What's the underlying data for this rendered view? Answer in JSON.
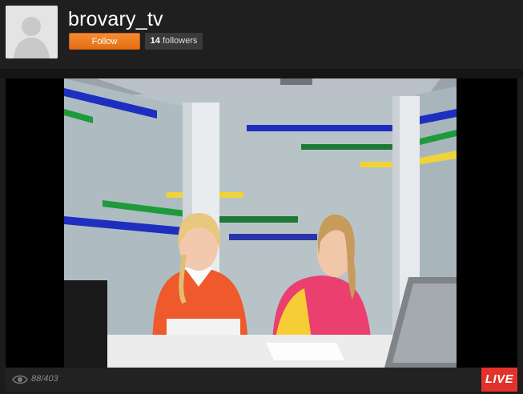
{
  "channel": {
    "name": "brovary_tv",
    "follow_label": "Follow",
    "followers_count": "14",
    "followers_label": "followers"
  },
  "player": {
    "viewers": "88/403",
    "live_label": "LIVE"
  },
  "icons": {
    "avatar": "default-user-silhouette",
    "viewers": "eye-icon"
  },
  "colors": {
    "follow": "#f08224",
    "live": "#e3322c"
  }
}
